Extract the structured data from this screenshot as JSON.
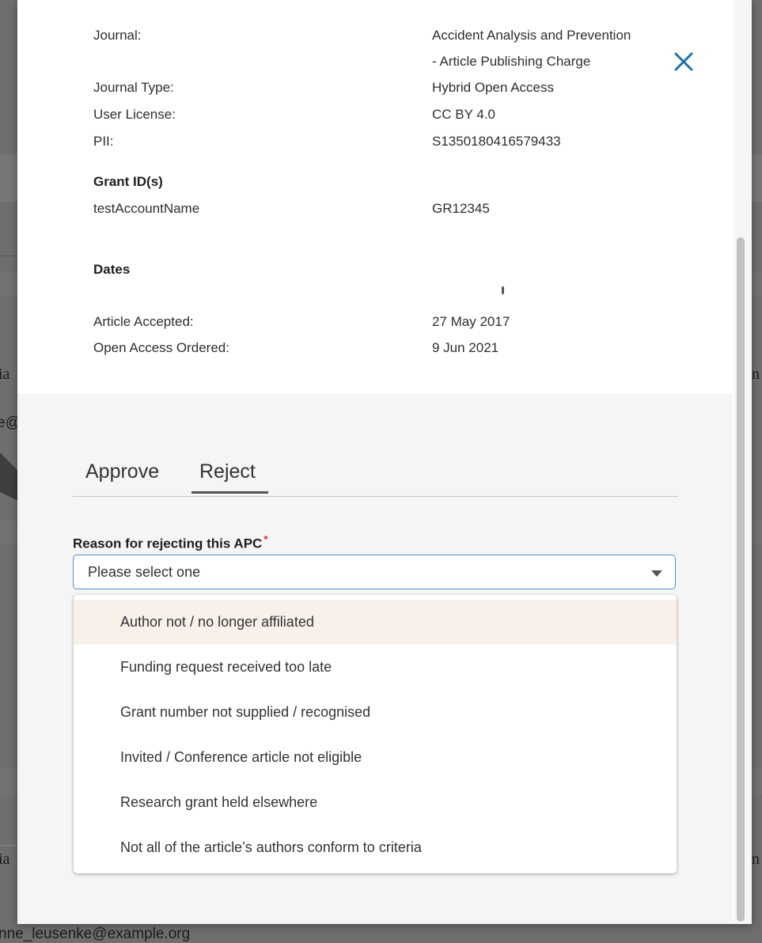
{
  "background": {
    "row_text_left": "ia",
    "row_text_right": "n",
    "email_fragment": "e@",
    "email_bottom": "nne_leusenke@example.org"
  },
  "details": {
    "journal_label": "Journal:",
    "journal_value_1": "Accident Analysis and Prevention",
    "journal_value_2": "- Article Publishing Charge",
    "journal_type_label": "Journal Type:",
    "journal_type_value": "Hybrid Open Access",
    "license_label": "User License:",
    "license_value": "CC BY 4.0",
    "pii_label": "PII:",
    "pii_value": "S1350180416579433"
  },
  "grants": {
    "heading": "Grant ID(s)",
    "account": "testAccountName",
    "grant_id": "GR12345"
  },
  "dates": {
    "heading": "Dates",
    "accepted_label": "Article Accepted:",
    "accepted_value": "27 May 2017",
    "ordered_label": "Open Access Ordered:",
    "ordered_value": "9 Jun 2021"
  },
  "tabs": {
    "approve": "Approve",
    "reject": "Reject",
    "active": "Reject"
  },
  "reject_form": {
    "label": "Reason for rejecting this APC",
    "required_mark": "*",
    "placeholder": "Please select one",
    "options": [
      "Author not / no longer affiliated",
      "Funding request received too late",
      "Grant number not supplied / recognised",
      "Invited / Conference article not eligible",
      "Research grant held elsewhere",
      "Not all of the article’s authors conform to criteria"
    ],
    "highlighted_option": "Author not / no longer affiliated"
  },
  "icons": {
    "close": "close-icon",
    "caret": "chevron-down-icon"
  },
  "colors": {
    "accent": "#1a6fb0",
    "focus_border": "#4a90d9",
    "required": "#e02020",
    "option_highlight": "#f7f1ea"
  }
}
